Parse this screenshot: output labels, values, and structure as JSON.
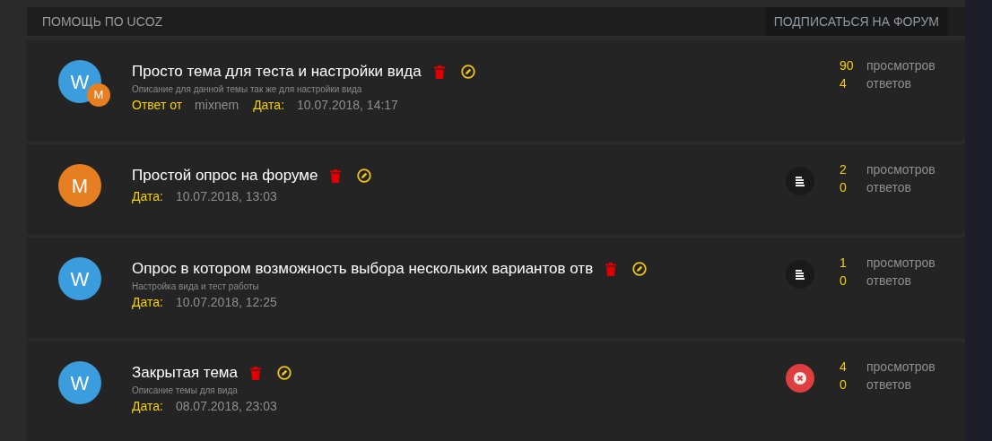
{
  "header": {
    "title": "ПОМОЩЬ ПО UCOZ",
    "subscribe_button": "ПОДПИСАТЬСЯ НА ФОРУМ"
  },
  "topics": [
    {
      "avatar": {
        "letter": "W",
        "color": "#3b9ddd"
      },
      "badge": {
        "letter": "M",
        "color": "#e67e22"
      },
      "title": "Просто тема для теста и настройки вида",
      "description": "Описание для данной темы так же для настройки вида",
      "reply_label": "Ответ от",
      "reply_author": "mixnem",
      "date_label": "Дата:",
      "date": "10.07.2018, 14:17",
      "views": "90",
      "views_label": "просмотров",
      "replies": "4",
      "replies_label": "ответов"
    },
    {
      "avatar": {
        "letter": "M",
        "color": "#e67e22"
      },
      "title": "Простой опрос на форуме",
      "date_label": "Дата:",
      "date": "10.07.2018, 13:03",
      "status": {
        "kind": "poll"
      },
      "views": "2",
      "views_label": "просмотров",
      "replies": "0",
      "replies_label": "ответов"
    },
    {
      "avatar": {
        "letter": "W",
        "color": "#3b9ddd"
      },
      "title": "Опрос в котором возможность выбора нескольких вариантов отв",
      "description": "Настройка вида и тест работы",
      "date_label": "Дата:",
      "date": "10.07.2018, 12:25",
      "status": {
        "kind": "poll"
      },
      "views": "1",
      "views_label": "просмотров",
      "replies": "0",
      "replies_label": "ответов"
    },
    {
      "avatar": {
        "letter": "W",
        "color": "#3b9ddd"
      },
      "title": "Закрытая тема",
      "description": "Описание темы для вида",
      "date_label": "Дата:",
      "date": "08.07.2018, 23:03",
      "status": {
        "kind": "closed"
      },
      "views": "4",
      "views_label": "просмотров",
      "replies": "0",
      "replies_label": "ответов"
    }
  ]
}
